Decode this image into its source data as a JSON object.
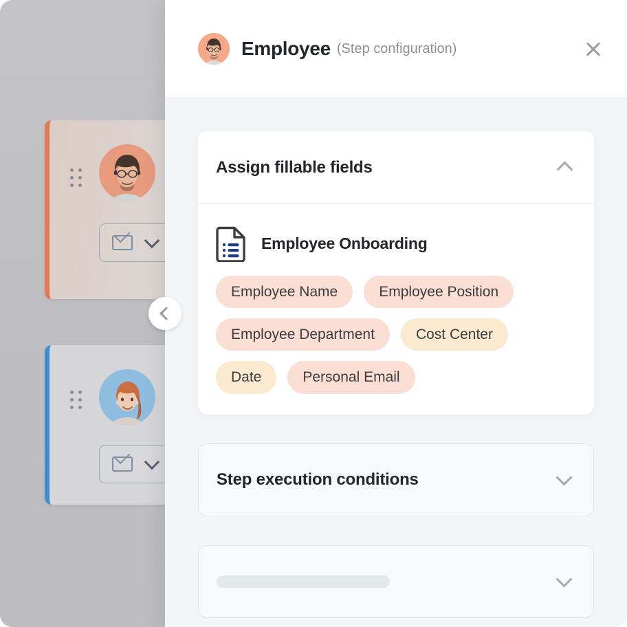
{
  "header": {
    "avatar_name": "employee-avatar-photo",
    "title": "Employee",
    "subtitle": "(Step configuration)",
    "close_label": "×",
    "close_icon": "close-icon"
  },
  "collapse_button": {
    "icon": "chevron-left-icon"
  },
  "background_cards": [
    {
      "id": "card-orange",
      "accent_color": "#e07a52",
      "avatar_bg": "#e89a7e",
      "drag_icon": "drag-handle-icon",
      "action_icon": "envelope-icon",
      "dropdown_icon": "chevron-down-icon"
    },
    {
      "id": "card-blue",
      "accent_color": "#3f8ed0",
      "avatar_bg": "#8fbde0",
      "drag_icon": "drag-handle-icon",
      "action_icon": "envelope-icon",
      "dropdown_icon": "chevron-down-icon"
    }
  ],
  "sections": {
    "assign_fillable_fields": {
      "title": "Assign fillable fields",
      "expanded": true,
      "chevron_icon": "chevron-up-icon",
      "document": {
        "icon": "document-list-icon",
        "name": "Employee Onboarding"
      },
      "fields": [
        {
          "label": "Employee Name",
          "color": "pink"
        },
        {
          "label": "Employee Position",
          "color": "pink"
        },
        {
          "label": "Employee Department",
          "color": "pink"
        },
        {
          "label": "Cost Center",
          "color": "cream"
        },
        {
          "label": "Date",
          "color": "cream"
        },
        {
          "label": "Personal Email",
          "color": "pink"
        }
      ]
    },
    "step_execution_conditions": {
      "title": "Step execution conditions",
      "expanded": false,
      "chevron_icon": "chevron-down-icon"
    },
    "loading_section": {
      "title": "",
      "expanded": false,
      "chevron_icon": "chevron-down-icon",
      "skeleton": true
    }
  },
  "colors": {
    "tag_pink": "#fbdfd4",
    "tag_cream": "#fbeacf",
    "accent_orange": "#e07a52",
    "accent_blue": "#3f8ed0",
    "panel_bg": "#f4f5f7",
    "doc_icon_accent": "#1f3b86"
  }
}
